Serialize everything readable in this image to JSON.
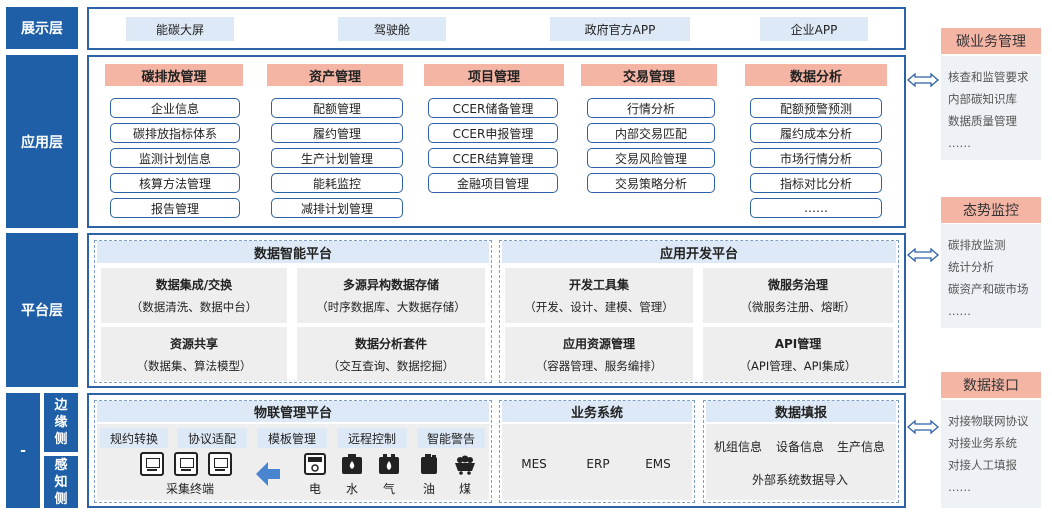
{
  "layers": {
    "display": "展示层",
    "application": "应用层",
    "platform": "平台层",
    "edge_dash": "-",
    "edge_side": "边缘侧",
    "sense_side": "感知侧"
  },
  "display_items": [
    "能碳大屏",
    "驾驶舱",
    "政府官方APP",
    "企业APP"
  ],
  "app_columns": [
    {
      "title": "碳排放管理",
      "items": [
        "企业信息",
        "碳排放指标体系",
        "监测计划信息",
        "核算方法管理",
        "报告管理"
      ]
    },
    {
      "title": "资产管理",
      "items": [
        "配额管理",
        "履约管理",
        "生产计划管理",
        "能耗监控",
        "减排计划管理"
      ]
    },
    {
      "title": "项目管理",
      "items": [
        "CCER储备管理",
        "CCER申报管理",
        "CCER结算管理",
        "金融项目管理"
      ]
    },
    {
      "title": "交易管理",
      "items": [
        "行情分析",
        "内部交易匹配",
        "交易风险管理",
        "交易策略分析"
      ]
    },
    {
      "title": "数据分析",
      "items": [
        "配额预警预测",
        "履约成本分析",
        "市场行情分析",
        "指标对比分析",
        "……"
      ]
    }
  ],
  "platform": {
    "data_platform": {
      "title": "数据智能平台",
      "cells": [
        {
          "title": "数据集成/交换",
          "sub": "（数据清洗、数据中台）"
        },
        {
          "title": "多源异构数据存储",
          "sub": "（时序数据库、大数据存储）"
        },
        {
          "title": "资源共享",
          "sub": "（数据集、算法模型）"
        },
        {
          "title": "数据分析套件",
          "sub": "（交互查询、数据挖掘）"
        }
      ]
    },
    "dev_platform": {
      "title": "应用开发平台",
      "cells": [
        {
          "title": "开发工具集",
          "sub": "（开发、设计、建模、管理）"
        },
        {
          "title": "微服务治理",
          "sub": "（微服务注册、熔断）"
        },
        {
          "title": "应用资源管理",
          "sub": "（容器管理、服务编排）"
        },
        {
          "title": "API管理",
          "sub": "（API管理、API集成）"
        }
      ]
    }
  },
  "edge": {
    "iot": {
      "title": "物联管理平台",
      "tags": [
        "规约转换",
        "协议适配",
        "模板管理",
        "远程控制",
        "智能警告"
      ],
      "terminal_label": "采集终端",
      "energy": [
        "电",
        "水",
        "气",
        "油",
        "煤"
      ]
    },
    "business": {
      "title": "业务系统",
      "systems": [
        "MES",
        "ERP",
        "EMS"
      ]
    },
    "report": {
      "title": "数据填报",
      "items": [
        "机组信息",
        "设备信息",
        "生产信息"
      ],
      "import": "外部系统数据导入"
    }
  },
  "right_panels": [
    {
      "title": "碳业务管理",
      "lines": [
        "核查和监管要求",
        "内部碳知识库",
        "数据质量管理",
        "……"
      ]
    },
    {
      "title": "态势监控",
      "lines": [
        "碳排放监测",
        "统计分析",
        "碳资产和碳市场",
        "……"
      ]
    },
    {
      "title": "数据接口",
      "lines": [
        "对接物联网协议",
        "对接业务系统",
        "对接人工填报",
        "……"
      ]
    }
  ],
  "colors": {
    "primary": "#1f5fa8",
    "frame": "#2d62a6",
    "salmon": "#f5b5a5",
    "light_blue": "#dde9f6",
    "gray": "#eeeeee"
  }
}
